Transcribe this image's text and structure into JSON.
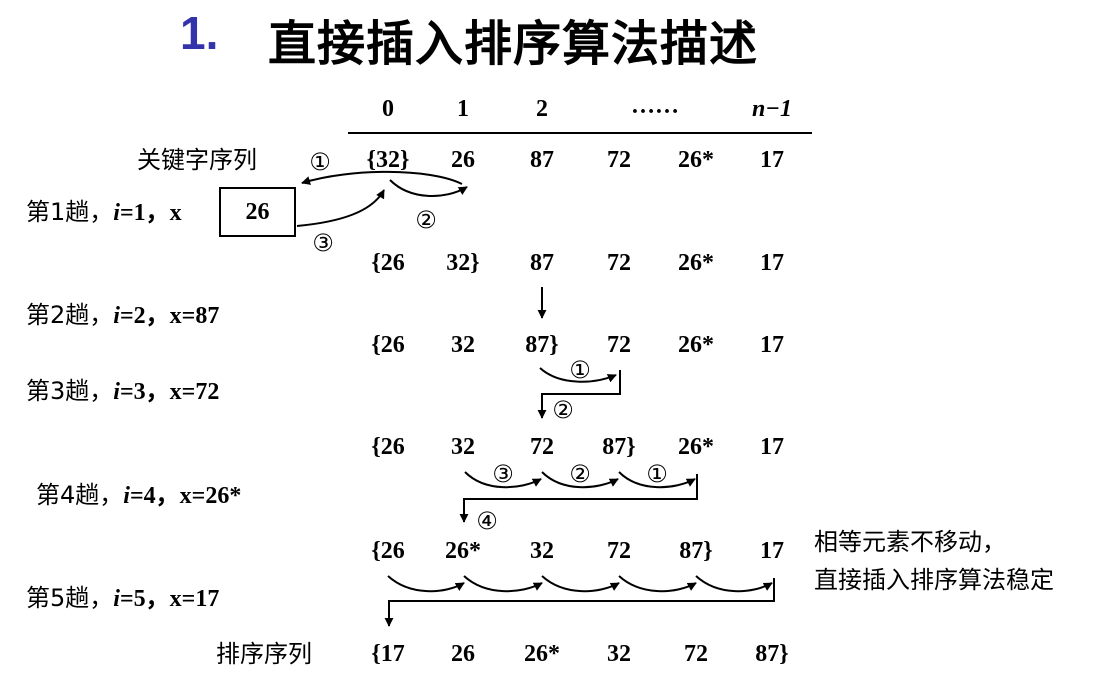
{
  "title": {
    "number": "1.",
    "text": "直接插入排序算法描述"
  },
  "index_header": [
    "0",
    "1",
    "2",
    "……",
    "n−1"
  ],
  "key_label": "关键字序列",
  "initial_sequence": [
    "{32}",
    "26",
    "87",
    "72",
    "26*",
    "17"
  ],
  "passes": [
    {
      "label_prefix": "第1趟，",
      "i_label": "i",
      "i_value": "=1，",
      "x_label": "x",
      "x_value": "26",
      "result": [
        "{26",
        "32}",
        "87",
        "72",
        "26*",
        "17"
      ],
      "steps": [
        "①",
        "②",
        "③"
      ]
    },
    {
      "label_prefix": "第2趟，",
      "i_label": "i",
      "i_value": "=2，",
      "x_text": "x=87",
      "result": [
        "{26",
        "32",
        "87}",
        "72",
        "26*",
        "17"
      ]
    },
    {
      "label_prefix": "第3趟，",
      "i_label": "i",
      "i_value": "=3，",
      "x_text": "x=72",
      "result": [
        "{26",
        "32",
        "72",
        "87}",
        "26*",
        "17"
      ],
      "steps": [
        "①",
        "②"
      ]
    },
    {
      "label_prefix": "第4趟，",
      "i_label": "i",
      "i_value": "=4，",
      "x_text": "x=26*",
      "result": [
        "{26",
        "26*",
        "32",
        "72",
        "87}",
        "17"
      ],
      "steps": [
        "③",
        "②",
        "①",
        "④"
      ]
    },
    {
      "label_prefix": "第5趟，",
      "i_label": "i",
      "i_value": "=5，",
      "x_text": "x=17"
    }
  ],
  "sorted_label": "排序序列",
  "sorted_sequence": [
    "{17",
    "26",
    "26*",
    "32",
    "72",
    "87}"
  ],
  "note": {
    "line1": "相等元素不移动，",
    "line2": "直接插入排序算法稳定"
  }
}
